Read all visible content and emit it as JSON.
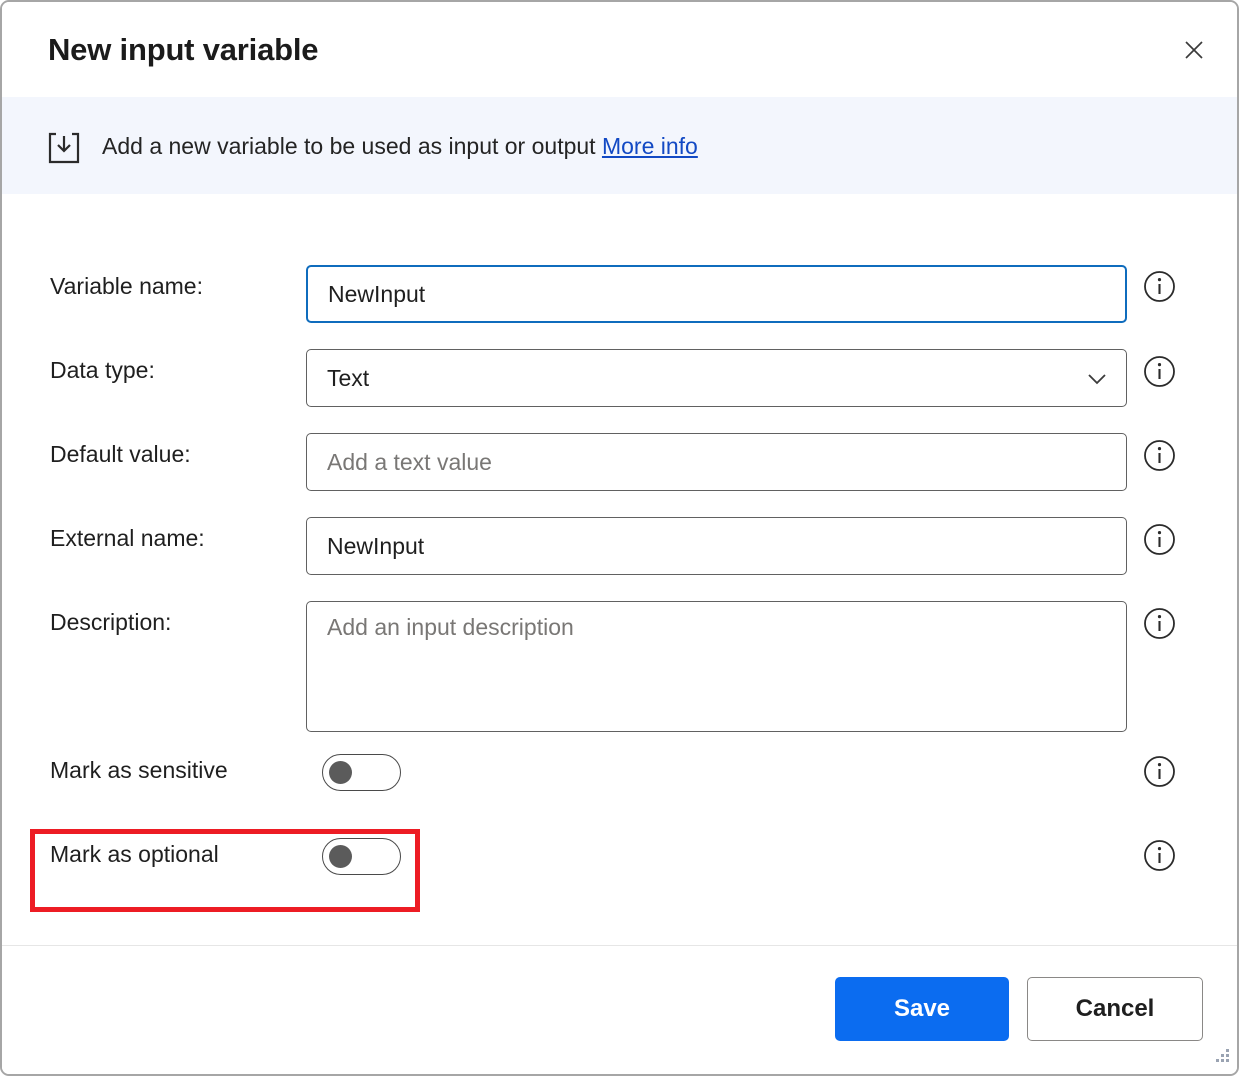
{
  "window": {
    "title": "New input variable",
    "close_icon": "close-icon",
    "resize_grip": "resize-grip"
  },
  "banner": {
    "icon": "input-download-icon",
    "text": "Add a new variable to be used as input or output",
    "link_label": "More info",
    "background_color": "#f3f6fd",
    "link_color": "#1249c4"
  },
  "form": {
    "fields": [
      {
        "label": "Variable name:",
        "type": "text",
        "value": "NewInput",
        "placeholder": "",
        "focused": true,
        "info_icon": "info-icon"
      },
      {
        "label": "Data type:",
        "type": "select",
        "value": "Text",
        "placeholder": "",
        "focused": false,
        "chevron_icon": "chevron-down-icon",
        "info_icon": "info-icon"
      },
      {
        "label": "Default value:",
        "type": "text",
        "value": "",
        "placeholder": "Add a text value",
        "focused": false,
        "info_icon": "info-icon"
      },
      {
        "label": "External name:",
        "type": "text",
        "value": "NewInput",
        "placeholder": "",
        "focused": false,
        "info_icon": "info-icon"
      },
      {
        "label": "Description:",
        "type": "textarea",
        "value": "",
        "placeholder": "Add an input description",
        "focused": false,
        "info_icon": "info-icon"
      }
    ],
    "toggles": [
      {
        "label": "Mark as sensitive",
        "state": "off",
        "info_icon": "info-icon",
        "highlighted": false
      },
      {
        "label": "Mark as optional",
        "state": "off",
        "info_icon": "info-icon",
        "highlighted": true
      }
    ]
  },
  "annotation": {
    "color": "#ed1c24",
    "target": "Mark as optional"
  },
  "footer": {
    "save_label": "Save",
    "cancel_label": "Cancel",
    "save_color": "#0b6cf0"
  }
}
